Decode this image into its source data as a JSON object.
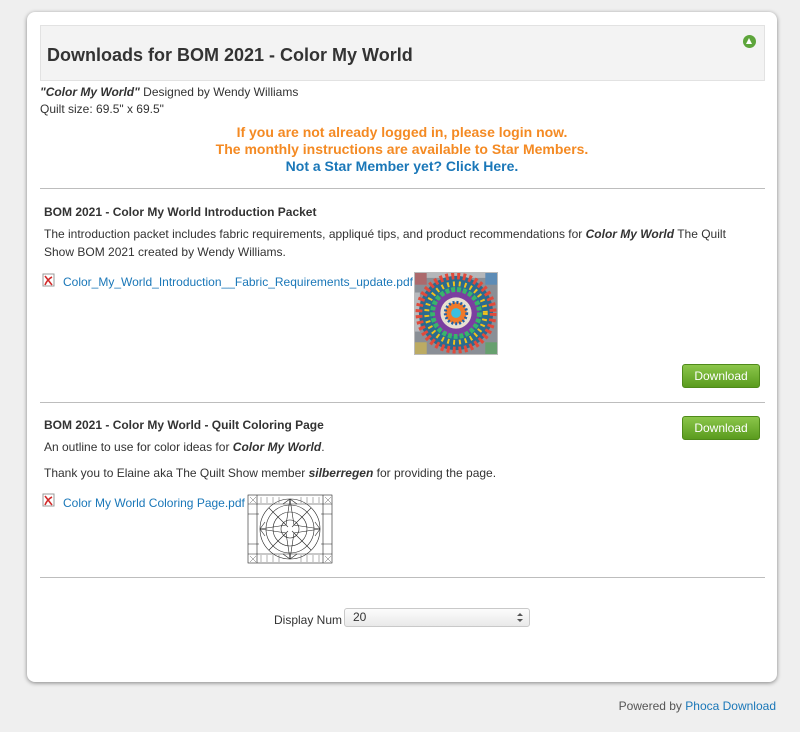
{
  "header": {
    "title": "Downloads for BOM 2021 - Color My World"
  },
  "intro": {
    "design_name": "\"Color My World\"",
    "designed_by": " Designed by Wendy Williams",
    "quilt_size": "Quilt size: 69.5\" x 69.5\""
  },
  "notice": {
    "line1": "If you are not already logged in, please login now.",
    "line2": "The monthly instructions are available to Star Members.",
    "line3": "Not a Star Member yet? Click Here",
    "line3_period": "."
  },
  "files": [
    {
      "title": "BOM 2021 - Color My World Introduction Packet",
      "desc_part1": "The introduction packet includes fabric requirements, appliqué tips, and product recommendations for ",
      "desc_em": "Color My World",
      "desc_part2": " The Quilt Show BOM 2021 created by Wendy Williams.",
      "filename": "Color_My_World_Introduction__Fabric_Requirements_update.pdf",
      "download_label": "Download"
    },
    {
      "title": "BOM 2021 - Color My World - Quilt Coloring Page",
      "desc_part1": "An outline to use for color ideas for ",
      "desc_em": "Color My World",
      "desc_part2": ".",
      "thanks_part1": "Thank you to Elaine aka The Quilt Show member ",
      "thanks_em": "silberregen",
      "thanks_part2": " for providing the page.",
      "filename": "Color My World Coloring Page.pdf",
      "download_label": "Download"
    }
  ],
  "pagination": {
    "display_num_label": "Display Num",
    "display_num_value": "20"
  },
  "footer": {
    "powered_by": "Powered by ",
    "link": "Phoca Download"
  },
  "colors": {
    "accent_orange": "#f48a23",
    "link_blue": "#1a77b8",
    "button_green": "#6bab2c"
  }
}
